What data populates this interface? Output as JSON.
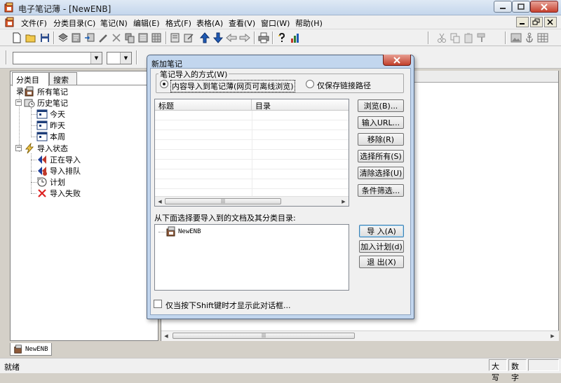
{
  "window": {
    "title": "电子笔记薄 - [NewENB]"
  },
  "menu": [
    "文件(F)",
    "分类目录(C)",
    "笔记(N)",
    "编辑(E)",
    "格式(F)",
    "表格(A)",
    "查看(V)",
    "窗口(W)",
    "帮助(H)"
  ],
  "left_panel": {
    "tabs": [
      "分类目录",
      "搜索"
    ],
    "tree": {
      "all_notes": "所有笔记",
      "history": "历史笔记",
      "today": "今天",
      "yesterday": "昨天",
      "this_week": "本周",
      "import_status": "导入状态",
      "importing": "正在导入",
      "queued": "导入排队",
      "scheduled": "计划",
      "failed": "导入失败"
    }
  },
  "document_tab": "NewENB",
  "status_bar": {
    "text": "就绪",
    "caps": "大写",
    "num": "数字"
  },
  "dialog": {
    "title": "新加笔记",
    "group_title": "笔记导入的方式(W)",
    "option_content": "内容导入到笔记薄(网页可离线浏览)",
    "option_link": "仅保存链接路径",
    "selected_option": "content",
    "list_columns": [
      "标题",
      "目录"
    ],
    "buttons_list": {
      "browse": "浏览(B)...",
      "input_url": "输入URL...",
      "remove": "移除(R)",
      "select_all": "选择所有(S)",
      "clear_selection": "清除选择(U)",
      "filter": "条件筛选..."
    },
    "tree_label": "从下面选择要导入到的文档及其分类目录:",
    "target_doc": "NewENB",
    "buttons_action": {
      "import": "导  入(A)",
      "add_schedule": "加入计划(d)",
      "exit": "退  出(X)"
    },
    "checkbox_label": "仅当按下Shift键时才显示此对话框...",
    "checkbox_checked": false
  },
  "colors": {
    "title_gradient_top": "#dfe9f5",
    "close_red": "#c7422f",
    "dialog_frame": "#c2d6ee",
    "default_button_border": "#3c7fb1"
  }
}
